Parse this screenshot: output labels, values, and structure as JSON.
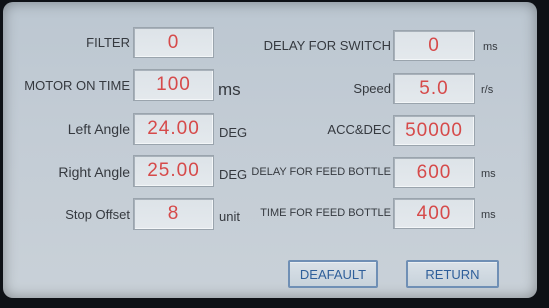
{
  "left_params": [
    {
      "label": "FILTER",
      "value": "0",
      "unit": ""
    },
    {
      "label": "MOTOR ON TIME",
      "value": "100",
      "unit": "ms"
    },
    {
      "label": "Left Angle",
      "value": "24.00",
      "unit": "DEG"
    },
    {
      "label": "Right Angle",
      "value": "25.00",
      "unit": "DEG"
    },
    {
      "label": "Stop Offset",
      "value": "8",
      "unit": "unit"
    }
  ],
  "right_params": [
    {
      "label": "DELAY FOR SWITCH",
      "value": "0",
      "unit": "ms"
    },
    {
      "label": "Speed",
      "value": "5.0",
      "unit": "r/s"
    },
    {
      "label": "ACC&DEC",
      "value": "50000",
      "unit": ""
    },
    {
      "label": "DELAY FOR FEED BOTTLE",
      "value": "600",
      "unit": "ms"
    },
    {
      "label": "TIME FOR FEED BOTTLE",
      "value": "400",
      "unit": "ms"
    }
  ],
  "buttons": {
    "default_label": "DEAFAULT",
    "return_label": "RETURN"
  },
  "colors": {
    "value_text": "#d64a4a",
    "button_text": "#2f5f9a",
    "button_border": "#6f8fb5",
    "screen_bg": "#c3ccd5"
  }
}
